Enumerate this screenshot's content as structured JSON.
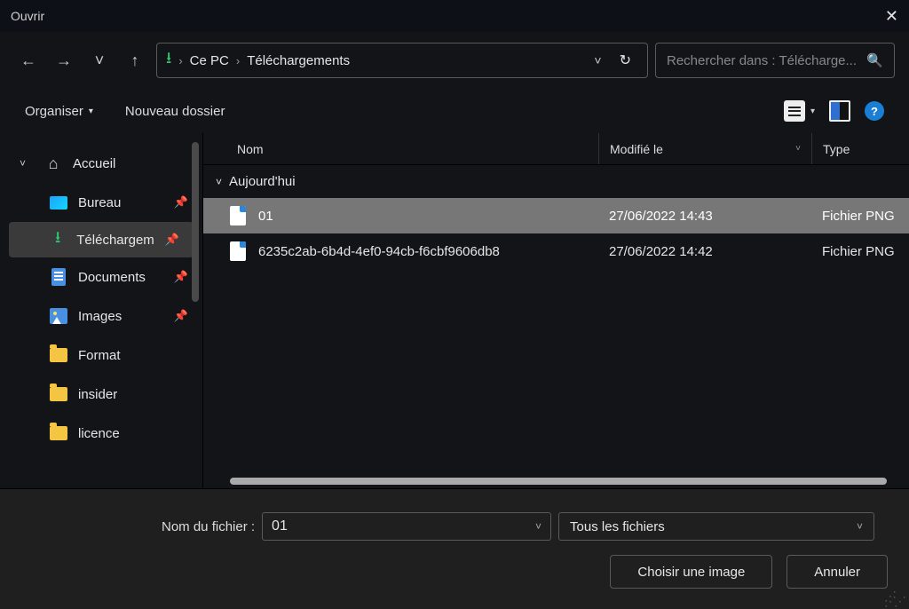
{
  "title": "Ouvrir",
  "breadcrumbs": {
    "root": "Ce PC",
    "current": "Téléchargements"
  },
  "search_placeholder": "Rechercher dans : Télécharge...",
  "toolbar": {
    "organize": "Organiser",
    "newfolder": "Nouveau dossier"
  },
  "sidebar": {
    "home": "Accueil",
    "items": [
      {
        "label": "Bureau"
      },
      {
        "label": "Téléchargem"
      },
      {
        "label": "Documents"
      },
      {
        "label": "Images"
      },
      {
        "label": "Format"
      },
      {
        "label": "insider"
      },
      {
        "label": "licence"
      }
    ]
  },
  "columns": {
    "name": "Nom",
    "modified": "Modifié le",
    "type": "Type"
  },
  "group": "Aujourd'hui",
  "files": [
    {
      "name": "01",
      "modified": "27/06/2022 14:43",
      "type": "Fichier PNG"
    },
    {
      "name": "6235c2ab-6b4d-4ef0-94cb-f6cbf9606db8",
      "modified": "27/06/2022 14:42",
      "type": "Fichier PNG"
    }
  ],
  "footer": {
    "filename_label": "Nom du fichier :",
    "filename_value": "01",
    "filter": "Tous les fichiers",
    "open": "Choisir une image",
    "cancel": "Annuler"
  }
}
